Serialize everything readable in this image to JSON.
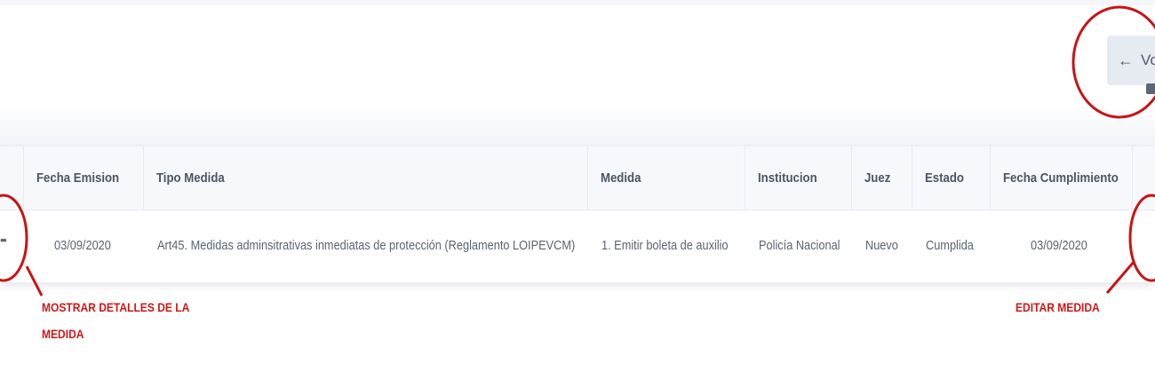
{
  "header": {
    "back_button_label": "Vol"
  },
  "table": {
    "columns": [
      "Fecha Emision",
      "Tipo Medida",
      "Medida",
      "Institucion",
      "Juez",
      "Estado",
      "Fecha Cumplimiento"
    ],
    "rows": [
      [
        "03/09/2020",
        "Art45. Medidas adminsitrativas inmediatas de protección (Reglamento LOIPEVCM)",
        "1. Emitir boleta de auxilio",
        "Policía Nacional",
        "Nuevo",
        "Cumplida",
        "03/09/2020"
      ]
    ]
  },
  "annotations": {
    "details_line1": "MOSTRAR DETALLES DE LA",
    "details_line2": "MEDIDA",
    "edit": "EDITAR MEDIDA"
  },
  "colors": {
    "annotation": "#d01818",
    "header_bg": "#f6f8fc",
    "button_bg": "#e6ebf2"
  },
  "icons": {
    "back": "arrow-left-icon",
    "details": "more-dots-icon",
    "edit": "edit-icon"
  }
}
